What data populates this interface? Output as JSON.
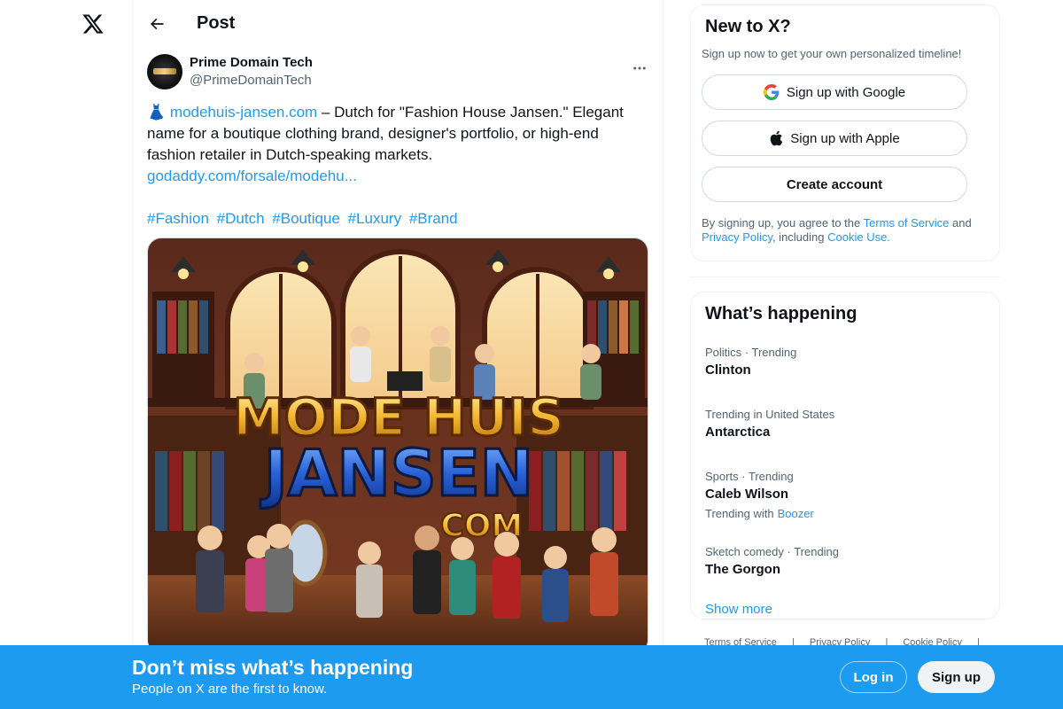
{
  "app": {
    "name": "X"
  },
  "header": {
    "title": "Post"
  },
  "post": {
    "author_name": "Prime Domain Tech",
    "author_handle": "@PrimeDomainTech",
    "emoji": "👗",
    "domain_link": "modehuis-jansen.com",
    "text": " – Dutch for \"Fashion House Jansen.\" Elegant name for a boutique clothing brand, designer's portfolio, or high-end fashion retailer in Dutch-speaking markets.",
    "sale_link": "godaddy.com/forsale/modehu...",
    "hashtags": [
      "#Fashion",
      "#Dutch",
      "#Boutique",
      "#Luxury",
      "#Brand"
    ],
    "image": {
      "sign_line1": "MODE HUIS",
      "sign_line2": "JANSEN",
      "sign_line3": ".COM"
    }
  },
  "signup": {
    "title": "New to X?",
    "subtitle": "Sign up now to get your own personalized timeline!",
    "google_label": "Sign up with Google",
    "apple_label": "Sign up with Apple",
    "create_label": "Create account",
    "terms_prefix": "By signing up, you agree to the ",
    "terms_link": "Terms of Service",
    "terms_and": " and ",
    "privacy_link": "Privacy Policy",
    "terms_including": ", including ",
    "cookie_link": "Cookie Use."
  },
  "trends": {
    "title": "What’s happening",
    "items": [
      {
        "meta": "Politics · Trending",
        "name": "Clinton"
      },
      {
        "meta": "Trending in United States",
        "name": "Antarctica"
      },
      {
        "meta": "Sports · Trending",
        "name": "Caleb Wilson",
        "with_label": "Trending with",
        "with_link": "Boozer"
      },
      {
        "meta": "Sketch comedy · Trending",
        "name": "The Gorgon"
      }
    ],
    "show_more": "Show more"
  },
  "footer": {
    "links": [
      "Terms of Service",
      "|",
      "Privacy Policy",
      "|",
      "Cookie Policy",
      "|"
    ]
  },
  "bottom_bar": {
    "title": "Don’t miss what’s happening",
    "subtitle": "People on X are the first to know.",
    "login": "Log in",
    "signup": "Sign up"
  },
  "colors": {
    "accent": "#1d9bf0",
    "text": "#0f1419",
    "muted": "#536471",
    "border": "#eff3f4"
  }
}
